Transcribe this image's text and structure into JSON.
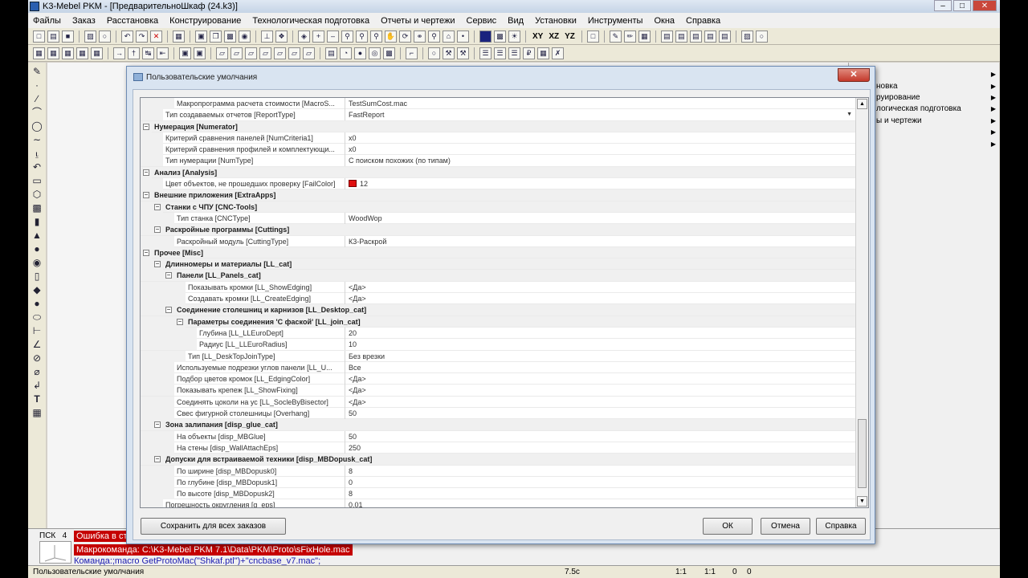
{
  "app": {
    "title": "K3-Mebel PKM - [ПредварительноШкаф (24.k3)]"
  },
  "menu": [
    "Файлы",
    "Заказ",
    "Расстановка",
    "Конструирование",
    "Технологическая подготовка",
    "Отчеты и чертежи",
    "Сервис",
    "Вид",
    "Установки",
    "Инструменты",
    "Окна",
    "Справка"
  ],
  "toolbar": {
    "xy": "XY",
    "xz": "XZ",
    "yz": "YZ"
  },
  "right_panel": {
    "items": [
      "новка",
      "руирование",
      "логическая подготовка",
      "ы и чертежи"
    ]
  },
  "dialog": {
    "title": "Пользовательские умолчания",
    "close": "✕",
    "rows": [
      {
        "type": "prop",
        "indent": 2,
        "name": "Макропрограмма расчета стоимости [MacroS...",
        "value": "TestSumCost.mac"
      },
      {
        "type": "prop",
        "indent": 1,
        "name": "Тип создаваемых отчетов [ReportType]",
        "value": "FastReport",
        "dropdown": true
      },
      {
        "type": "cat",
        "indent": 0,
        "name": "Нумерация [Numerator]"
      },
      {
        "type": "prop",
        "indent": 1,
        "name": "Критерий сравнения панелей [NumCriteria1]",
        "value": "x0"
      },
      {
        "type": "prop",
        "indent": 1,
        "name": "Критерий сравнения профилей и комплектующи...",
        "value": "x0"
      },
      {
        "type": "prop",
        "indent": 1,
        "name": "Тип нумерации [NumType]",
        "value": "С поиском похожих (по типам)"
      },
      {
        "type": "cat",
        "indent": 0,
        "name": "Анализ [Analysis]"
      },
      {
        "type": "prop",
        "indent": 1,
        "name": "Цвет объектов, не прошедших проверку [FailColor]",
        "value": "12",
        "swatch": "#e01010"
      },
      {
        "type": "cat",
        "indent": 0,
        "name": "Внешние приложения [ExtraApps]"
      },
      {
        "type": "cat",
        "indent": 1,
        "name": "Станки с ЧПУ [CNC-Tools]"
      },
      {
        "type": "prop",
        "indent": 2,
        "name": "Тип станка [CNCType]",
        "value": "WoodWop"
      },
      {
        "type": "cat",
        "indent": 1,
        "name": "Раскройные программы [Cuttings]"
      },
      {
        "type": "prop",
        "indent": 2,
        "name": "Раскройный модуль [CuttingType]",
        "value": "К3-Раскрой"
      },
      {
        "type": "cat",
        "indent": 0,
        "name": "Прочее [Misc]"
      },
      {
        "type": "cat",
        "indent": 1,
        "name": "Длинномеры и материалы [LL_cat]"
      },
      {
        "type": "cat",
        "indent": 2,
        "name": "Панели [LL_Panels_cat]"
      },
      {
        "type": "prop",
        "indent": 3,
        "name": "Показывать кромки [LL_ShowEdging]",
        "value": "<Да>"
      },
      {
        "type": "prop",
        "indent": 3,
        "name": "Создавать кромки [LL_CreateEdging]",
        "value": "<Да>"
      },
      {
        "type": "cat",
        "indent": 2,
        "name": "Соединение столешниц и карнизов [LL_Desktop_cat]"
      },
      {
        "type": "cat",
        "indent": 3,
        "name": "Параметры соединения 'С фаской' [LL_join_cat]"
      },
      {
        "type": "prop",
        "indent": 4,
        "name": "Глубина [LL_LLEuroDept]",
        "value": "20"
      },
      {
        "type": "prop",
        "indent": 4,
        "name": "Радиус [LL_LLEuroRadius]",
        "value": "10"
      },
      {
        "type": "prop",
        "indent": 3,
        "name": "Тип [LL_DeskTopJoinType]",
        "value": "Без врезки"
      },
      {
        "type": "prop",
        "indent": 2,
        "name": "Используемые подрезки углов панели [LL_U...",
        "value": "Все"
      },
      {
        "type": "prop",
        "indent": 2,
        "name": "Подбор цветов кромок [LL_EdgingColor]",
        "value": "<Да>"
      },
      {
        "type": "prop",
        "indent": 2,
        "name": "Показывать крепеж [LL_ShowFixing]",
        "value": "<Да>"
      },
      {
        "type": "prop",
        "indent": 2,
        "name": "Соединять цоколи на ус [LL_SocleByBisector]",
        "value": "<Да>"
      },
      {
        "type": "prop",
        "indent": 2,
        "name": "Свес фигурной столешницы [Overhang]",
        "value": "50"
      },
      {
        "type": "cat",
        "indent": 1,
        "name": "Зона залипания [disp_glue_cat]"
      },
      {
        "type": "prop",
        "indent": 2,
        "name": "На объекты [disp_MBGlue]",
        "value": "50"
      },
      {
        "type": "prop",
        "indent": 2,
        "name": "На стены [disp_WallAttachEps]",
        "value": "250"
      },
      {
        "type": "cat",
        "indent": 1,
        "name": "Допуски для встраиваемой техники [disp_MBDopusk_cat]"
      },
      {
        "type": "prop",
        "indent": 2,
        "name": "По ширине [disp_MBDopusk0]",
        "value": "8"
      },
      {
        "type": "prop",
        "indent": 2,
        "name": "По глубине [disp_MBDopusk1]",
        "value": "0"
      },
      {
        "type": "prop",
        "indent": 2,
        "name": "По высоте [disp_MBDopusk2]",
        "value": "8"
      },
      {
        "type": "prop",
        "indent": 1,
        "name": "Погрешность округления [g_eps]",
        "value": "0.01"
      }
    ],
    "buttons": {
      "save_all": "Сохранить для всех заказов",
      "ok": "ОК",
      "cancel": "Отмена",
      "help": "Справка"
    }
  },
  "command_area": {
    "psk_label": "ПСК",
    "psk_number": "4",
    "error_line": "Ошибка в ст",
    "macro_line": "Макрокоманда: C:\\K3-Mebel PKM 7.1\\Data\\PKM\\Proto\\sFixHole.mac",
    "command_line": "Команда:;macro GetProtoMac(\"Shkaf.ptl\")+\"cncbase_v7.mac\";"
  },
  "statusbar": {
    "text": "Пользовательские умолчания",
    "time": "7.5c",
    "scale1": "1:1",
    "scale2": "1:1",
    "v1": "0",
    "v2": "0"
  }
}
